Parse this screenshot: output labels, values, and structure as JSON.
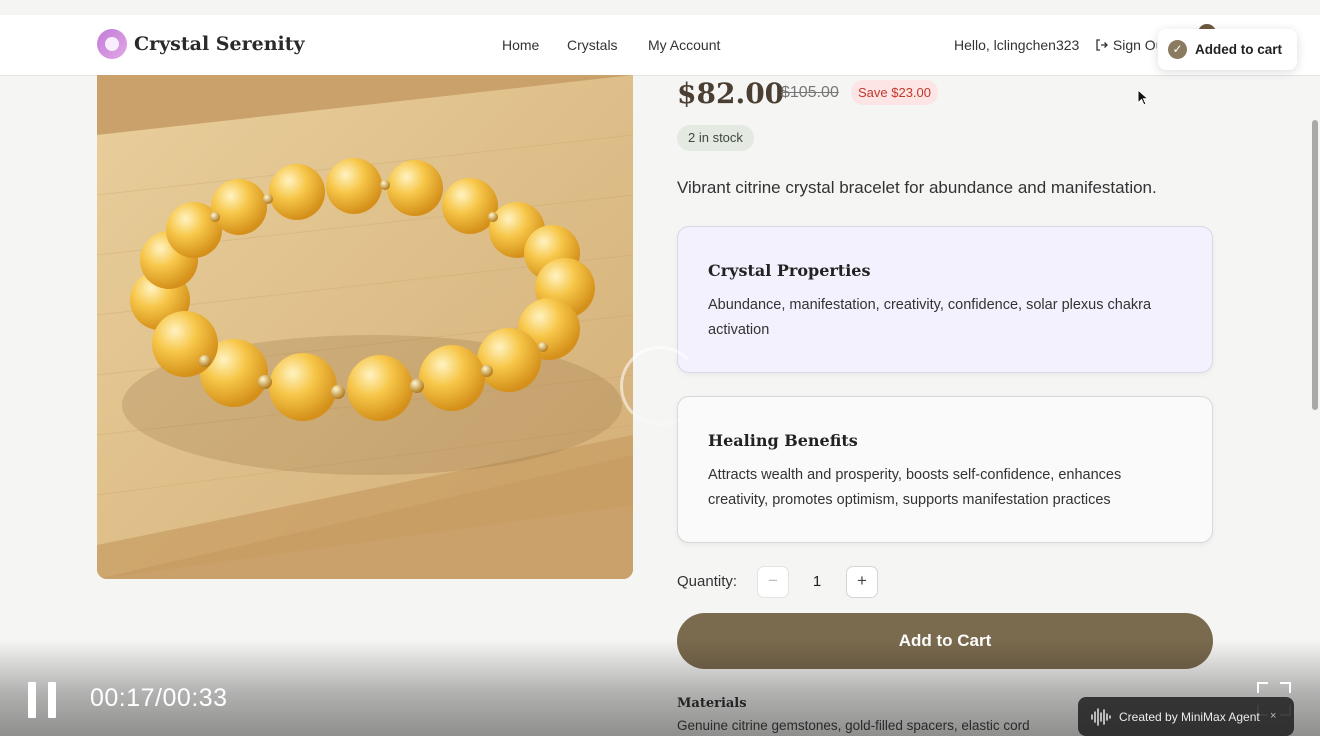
{
  "header": {
    "brand": "Crystal Serenity",
    "nav": [
      "Home",
      "Crystals",
      "My Account"
    ],
    "greeting": "Hello, lclingchen323",
    "sign_out": "Sign Out"
  },
  "toast": {
    "text": "Added to cart",
    "icon": "check-circle-icon"
  },
  "product": {
    "price": "$82.00",
    "original_price": "$105.00",
    "save": "Save $23.00",
    "stock": "2 in stock",
    "description": "Vibrant citrine crystal bracelet for abundance and manifestation.",
    "properties": {
      "title": "Crystal Properties",
      "body": "Abundance, manifestation, creativity, confidence, solar plexus chakra activation"
    },
    "benefits": {
      "title": "Healing Benefits",
      "body": "Attracts wealth and prosperity, boosts self-confidence, enhances creativity, promotes optimism, supports manifestation practices"
    },
    "quantity_label": "Quantity:",
    "quantity": "1",
    "minus": "−",
    "plus": "+",
    "add_to_cart": "Add to Cart",
    "materials_title": "Materials",
    "materials": "Genuine citrine gemstones, gold-filled spacers, elastic cord"
  },
  "video": {
    "timecode": "00:17/00:33",
    "watermark": "Created by MiniMax Agent",
    "close": "×"
  },
  "colors": {
    "accent": "#7a6a4e",
    "price": "#4a3f32",
    "save_bg": "#fde5e5",
    "save_text": "#c0392b",
    "properties_bg": "#f3f1fd"
  }
}
